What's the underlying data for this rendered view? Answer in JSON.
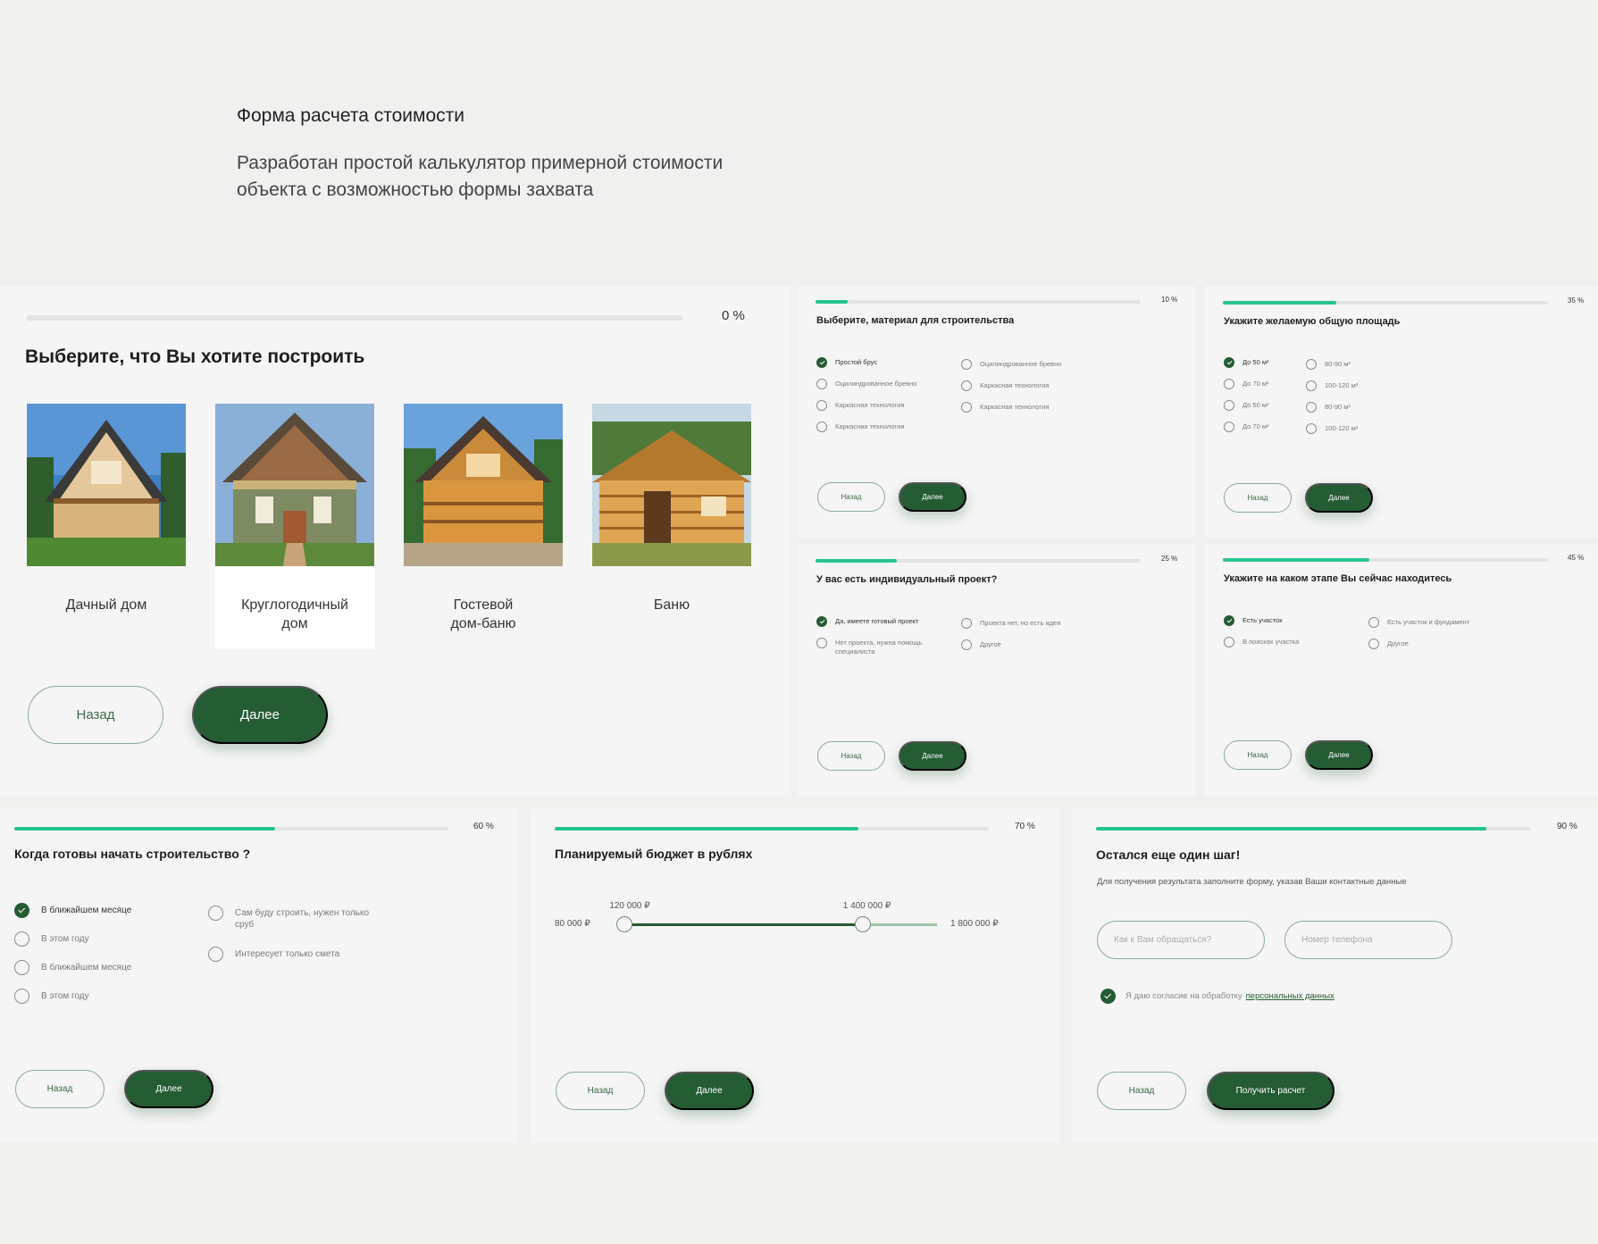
{
  "intro": {
    "title": "Форма расчета стоимости",
    "description": "Разработан простой калькулятор примерной стоимости объекта с возможностью формы захвата"
  },
  "colors": {
    "accent": "#26c48c",
    "primary": "#245c33",
    "background": "#f0f1ee",
    "card": "#f5f5f5"
  },
  "step1": {
    "progress": 0,
    "percent_label": "0 %",
    "question": "Выберите, что Вы хотите построить",
    "options": [
      {
        "label": "Дачный дом"
      },
      {
        "label": "Круглогодичный дом",
        "selected": true
      },
      {
        "label": "Гостевой дом-баню"
      },
      {
        "label": "Баню"
      }
    ],
    "back": "Назад",
    "next": "Далее"
  },
  "step2": {
    "progress": 10,
    "percent_label": "10 %",
    "question": "Выберите, материал для строительства",
    "col1": [
      "Простой брус",
      "Оцилиндрованное бревно",
      "Каркасная технология",
      "Каркасная технология"
    ],
    "col2": [
      "Оцилиндрованное бревно",
      "Каркасная технология",
      "Каркасная технология"
    ],
    "back": "Назад",
    "next": "Далее"
  },
  "step3": {
    "progress": 35,
    "percent_label": "35 %",
    "question": "Укажите желаемую общую площадь",
    "col1": [
      "До 50 м²",
      "До 70 м²",
      "До 50 м²",
      "До 70 м²"
    ],
    "col2": [
      "80-90 м²",
      "100-120 м²",
      "80-90 м²",
      "100-120 м²"
    ],
    "back": "Назад",
    "next": "Далее"
  },
  "step4": {
    "progress": 25,
    "percent_label": "25 %",
    "question": "У вас есть индивидуальный проект?",
    "col1": [
      "Да, имеете готовый проект",
      "Нет проекта, нужна помощь специалиста"
    ],
    "col2": [
      "Проекта нет, но есть идея",
      "Другое"
    ],
    "back": "Назад",
    "next": "Далее"
  },
  "step5": {
    "progress": 45,
    "percent_label": "45 %",
    "question": "Укажите на каком этапе Вы сейчас находитесь",
    "col1": [
      "Есть участок",
      "В поисках участка"
    ],
    "col2": [
      "Есть участок и фундамент",
      "Другое"
    ],
    "back": "Назад",
    "next": "Далее"
  },
  "step6": {
    "progress": 60,
    "percent_label": "60 %",
    "question": "Когда готовы начать строительство ?",
    "col1": [
      "В ближайшем месяце",
      "В этом году",
      "В ближайшем месяце",
      "В этом году"
    ],
    "col2": [
      "Сам буду строить, нужен только сруб",
      "Интересует только смета"
    ],
    "back": "Назад",
    "next": "Далее"
  },
  "step7": {
    "progress": 70,
    "percent_label": "70 %",
    "question": "Планируемый бюджет в рублях",
    "slider": {
      "min": 80000,
      "max": 1800000,
      "low": 120000,
      "high": 1400000,
      "min_label": "80 000 ₽",
      "max_label": "1 800 000 ₽",
      "low_label": "120 000 ₽",
      "high_label": "1 400 000 ₽"
    },
    "back": "Назад",
    "next": "Далее"
  },
  "step8": {
    "progress": 90,
    "percent_label": "90 %",
    "question": "Остался еще один шаг!",
    "subtitle": "Для получения результата заполните форму, указав Ваши контактные данные",
    "name_placeholder": "Как к Вам обращаться?",
    "phone_placeholder": "Номер телефона",
    "consent_text": "Я даю согласие на обработку",
    "consent_link": "персональных данных",
    "back": "Назад",
    "submit": "Получить расчет"
  }
}
